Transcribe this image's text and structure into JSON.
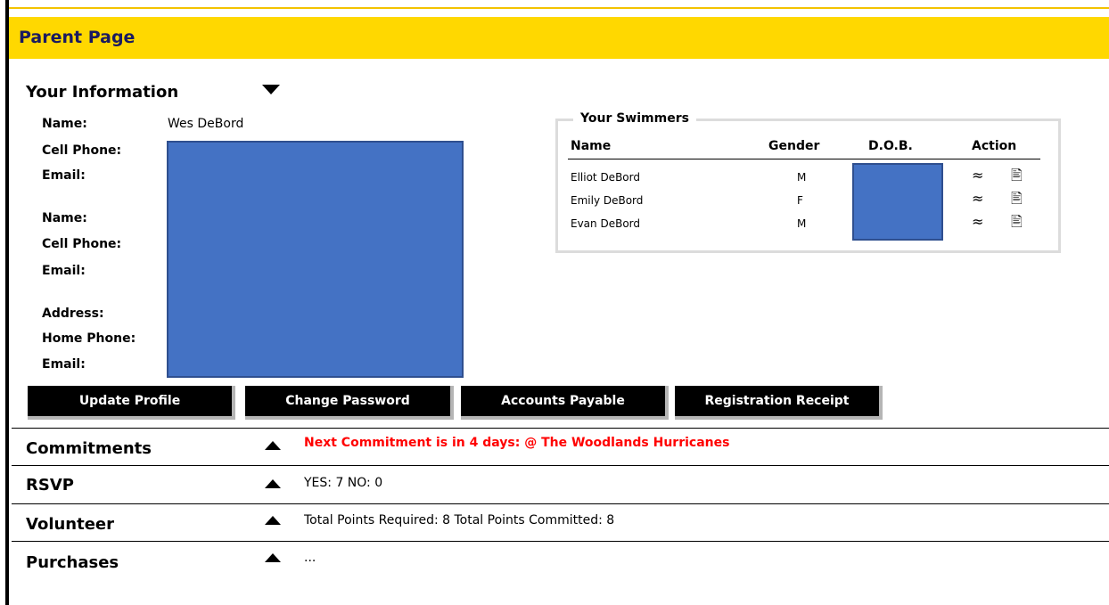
{
  "page": {
    "title": "Parent Page"
  },
  "your_information": {
    "title": "Your Information",
    "name_label": "Name:",
    "name_value": "Wes DeBord",
    "cell_phone_label": "Cell Phone:",
    "email_label": "Email:",
    "name2_label": "Name:",
    "cell_phone2_label": "Cell Phone:",
    "email2_label": "Email:",
    "address_label": "Address:",
    "home_phone_label": "Home Phone:",
    "email3_label": "Email:"
  },
  "swimmers": {
    "title": "Your Swimmers",
    "headers": {
      "name": "Name",
      "gender": "Gender",
      "dob": "D.O.B.",
      "action": "Action"
    },
    "rows": [
      {
        "name": "Elliot DeBord",
        "gender": "M"
      },
      {
        "name": "Emily DeBord",
        "gender": "F"
      },
      {
        "name": "Evan DeBord",
        "gender": "M"
      }
    ]
  },
  "buttons": {
    "update_profile": "Update Profile",
    "change_password": "Change Password",
    "accounts_payable": "Accounts Payable",
    "registration_receipt": "Registration Receipt"
  },
  "commitments": {
    "title": "Commitments",
    "text": "Next Commitment is in 4 days:   @ The Woodlands Hurricanes"
  },
  "rsvp": {
    "title": "RSVP",
    "text": "YES: 7 NO: 0"
  },
  "volunteer": {
    "title": "Volunteer",
    "text": "Total Points Required: 8 Total Points Committed: 8"
  },
  "purchases": {
    "title": "Purchases",
    "text": "..."
  },
  "colors": {
    "banner": "#ffd800",
    "redaction": "#4472c4",
    "alert": "#ff0000"
  },
  "icons": {
    "swim": "swimmer-icon",
    "doc": "document-edit-icon",
    "expand": "triangle-down-icon",
    "collapse": "triangle-up-icon"
  }
}
